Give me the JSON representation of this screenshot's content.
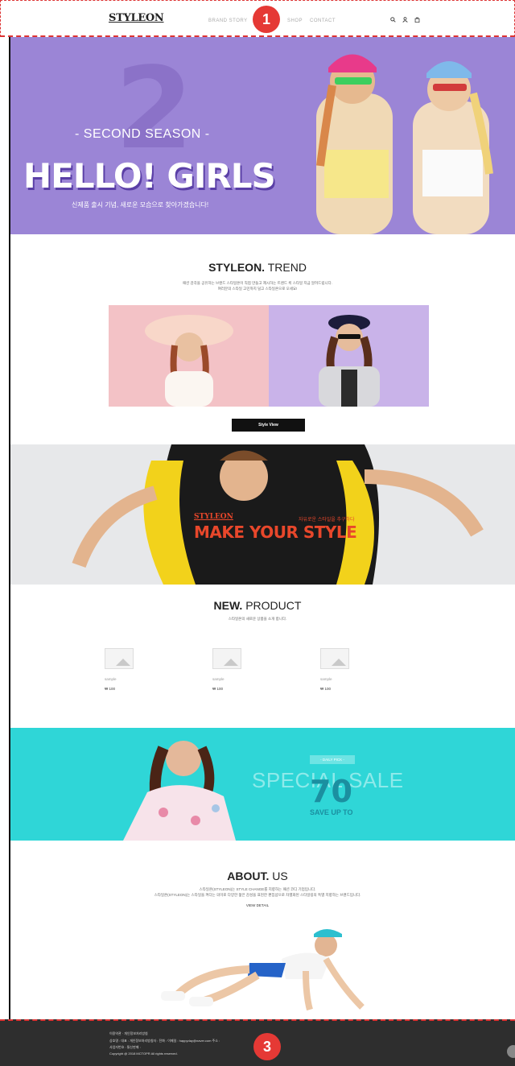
{
  "header": {
    "logo": "STYLEON",
    "nav": [
      "BRAND STORY",
      "SHOP",
      "CONTACT"
    ],
    "icons": [
      "search-icon",
      "user-icon",
      "bag-icon"
    ]
  },
  "badges": [
    "1",
    "3"
  ],
  "hero": {
    "number": "2",
    "season": "- SECOND SEASON -",
    "title": "HELLO! GIRLS",
    "subtitle": "신제품 출시 기념, 새로운 모습으로 찾아가겠습니다!"
  },
  "trend": {
    "title_bold": "STYLEON.",
    "title_light": " TREND",
    "desc1": "패션 감각을 공유하는 브랜드 스타일온이 직접 만들고 제시하는 트렌드 룩 스타일 지금 알려드립니다.",
    "desc2": "여러분의 스타일 고민까지 덜고 스타일온으로 오세요!",
    "button": "Style View"
  },
  "banner": {
    "logo": "STYLEON",
    "tag": "자유로운 스타일을 추구하다",
    "title": "MAKE YOUR STYLE"
  },
  "new_product": {
    "title_bold": "NEW.",
    "title_light": " PRODUCT",
    "desc": "스타일온의 새로운 상품을 소개 합니다.",
    "items": [
      {
        "name": "sample",
        "price": "₩ 100"
      },
      {
        "name": "sample",
        "price": "₩ 100"
      },
      {
        "name": "sample",
        "price": "₩ 100"
      }
    ]
  },
  "sale": {
    "pill": "- DAILY PICK -",
    "title": "SPECIAL SALE",
    "percent": "70",
    "save": "SAVE UP TO"
  },
  "about": {
    "title_bold": "ABOUT.",
    "title_light": " US",
    "desc1": "스타일온(STYLEON)는 STYLE CHANGE를 지향하는 패션 코디 기업입니다.",
    "desc2": "스타일온(STYLEON)는 스타일을 켜다는 의미로 다양한 젊은 감성을 표현한 편집샵으로 차별화된 스타일링의 특별 지향하는 브랜드입니다.",
    "link": "VIEW DETAIL"
  },
  "footer": {
    "line1": "이용약관 · 개인정보처리방침",
    "line2": "상호명 : 대표 : 개인정보처리방침자 : 전화 : 이메일 : happyday@naver.com 주소 :",
    "line3": "사업자번호 : 통신판매 :",
    "line4": "Copyright @ 2018 MCTOPR All rights reserved."
  },
  "colors": {
    "hero_bg": "#9b85d6",
    "sale_bg": "#2fd6d7",
    "accent": "#e8472b",
    "footer_bg": "#2e2e2e"
  }
}
